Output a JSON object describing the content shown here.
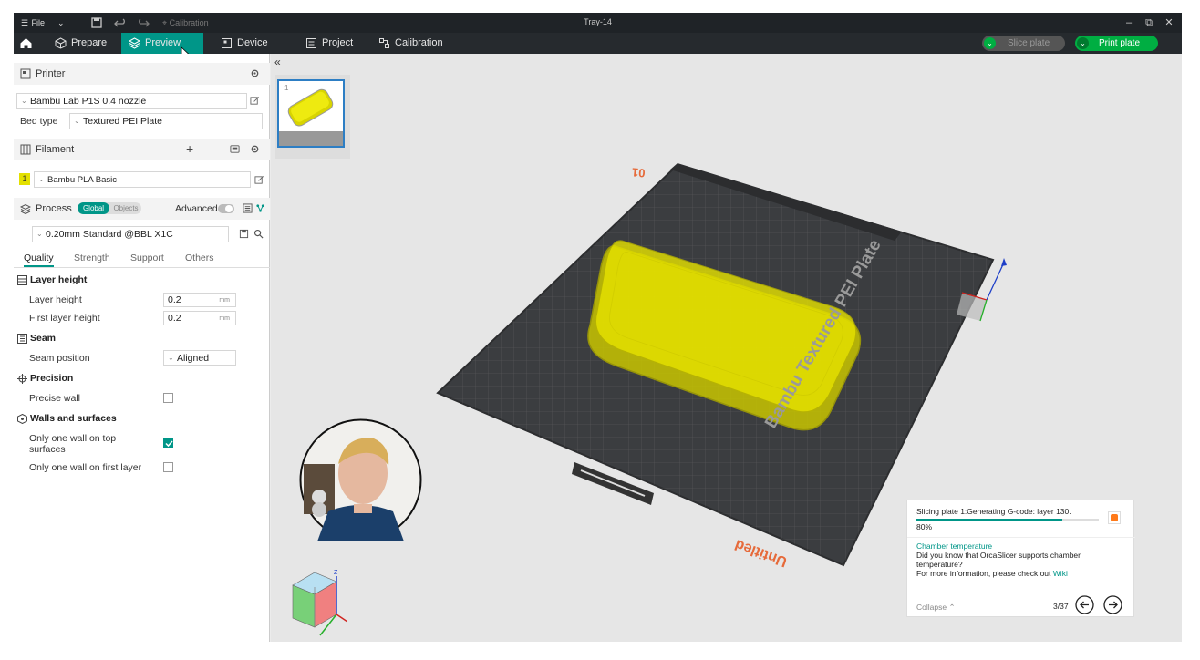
{
  "window": {
    "title": "Tray-14"
  },
  "titlebar": {
    "file_label": "File",
    "calibration_label": "Calibration"
  },
  "nav": {
    "tabs": [
      {
        "label": "Prepare"
      },
      {
        "label": "Preview"
      },
      {
        "label": "Device"
      },
      {
        "label": "Project"
      },
      {
        "label": "Calibration"
      }
    ],
    "active": "Preview",
    "slice_label": "Slice plate",
    "print_label": "Print plate"
  },
  "left": {
    "printer_header": "Printer",
    "printer_value": "Bambu Lab P1S 0.4 nozzle",
    "bed_type_label": "Bed type",
    "bed_type_value": "Textured PEI Plate",
    "filament_header": "Filament",
    "filament_index": "1",
    "filament_value": "Bambu PLA Basic",
    "process_header": "Process",
    "global_label": "Global",
    "objects_label": "Objects",
    "advanced_label": "Advanced",
    "process_value": "0.20mm Standard @BBL X1C",
    "subtabs": [
      "Quality",
      "Strength",
      "Support",
      "Others"
    ],
    "groups": {
      "layer_height": "Layer height",
      "seam": "Seam",
      "precision": "Precision",
      "walls": "Walls and surfaces"
    },
    "options": {
      "layer_height_label": "Layer height",
      "layer_height_value": "0.2",
      "first_layer_label": "First layer height",
      "first_layer_value": "0.2",
      "unit": "mm",
      "seam_position_label": "Seam position",
      "seam_position_value": "Aligned",
      "precise_wall_label": "Precise wall",
      "one_wall_top_label_1": "Only one wall on top",
      "one_wall_top_label_2": "surfaces",
      "one_wall_first_label": "Only one wall on first layer"
    },
    "checks": {
      "precise_wall": false,
      "one_wall_top": true,
      "one_wall_first": false
    }
  },
  "viewport": {
    "thumb_index": "1",
    "plate_number": "01",
    "plate_text": "Bambu Textured PEI Plate",
    "plate_name": "Untitled",
    "axis_z": "Z"
  },
  "notice": {
    "status": "Slicing plate 1:Generating G-code: layer 130.",
    "progress_text": "80%",
    "progress": 0.8,
    "tip_title": "Chamber temperature",
    "tip_line1": "Did you know that OrcaSlicer supports chamber",
    "tip_line2": "temperature?",
    "tip_line3": "For more information, please check out",
    "tip_link": "Wiki",
    "collapse_label": "Collapse",
    "page": "3/37"
  },
  "colors": {
    "accent": "#009688",
    "filament": "#e3e000",
    "print_green": "#00ae42"
  }
}
